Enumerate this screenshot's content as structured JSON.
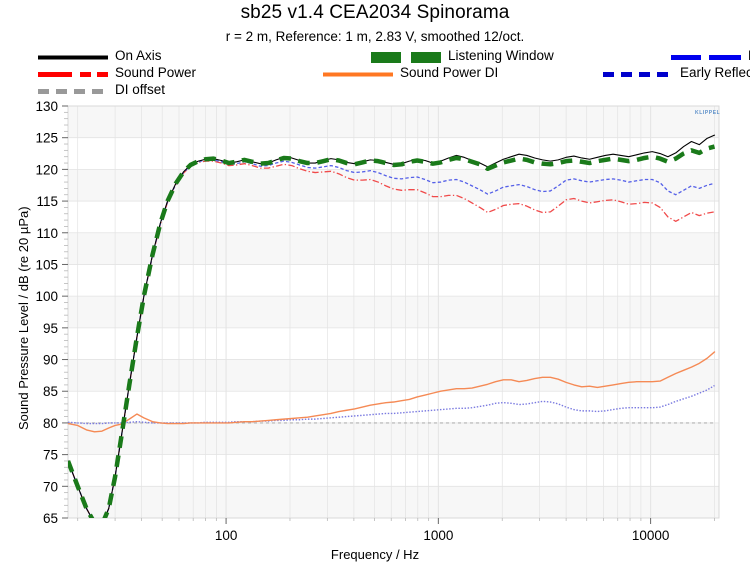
{
  "chart_data": {
    "type": "line",
    "title": "sb25 v1.4 CEA2034 Spinorama",
    "subtitle": "r = 2 m,  Reference: 1 m, 2.83 V, smoothed 12/oct.",
    "xlabel": "Frequency / Hz",
    "ylabel": "Sound Pressure Level / dB (re 20 µPa)",
    "xscale": "log",
    "xlim": [
      18,
      21000
    ],
    "ylim": [
      65,
      130
    ],
    "yticks": [
      65,
      70,
      75,
      80,
      85,
      90,
      95,
      100,
      105,
      110,
      115,
      120,
      125,
      130
    ],
    "xticks": [
      100,
      1000,
      10000
    ],
    "xtick_labels": [
      "100",
      "1000",
      "10000"
    ],
    "grid": true,
    "legend_position": "above-plot",
    "watermark": "KLIPPEL",
    "band_color": "#f7f7f7",
    "grid_color": "#e3e3e3",
    "series": [
      {
        "name": "On Axis",
        "color": "#000000",
        "style": "solid",
        "width": 1.1,
        "x": [
          18,
          20,
          22,
          24,
          26,
          28,
          30,
          32,
          35,
          38,
          41,
          45,
          49,
          53,
          58,
          63,
          68,
          74,
          80,
          87,
          95,
          103,
          112,
          122,
          133,
          145,
          158,
          172,
          187,
          204,
          222,
          242,
          263,
          287,
          312,
          340,
          370,
          403,
          439,
          478,
          520,
          566,
          616,
          671,
          730,
          795,
          866,
          942,
          1026,
          1117,
          1216,
          1324,
          1441,
          1569,
          1708,
          1860,
          2025,
          2204,
          2400,
          2613,
          2845,
          3097,
          3372,
          3671,
          3997,
          4351,
          4737,
          5158,
          5615,
          6113,
          6656,
          7246,
          7889,
          8589,
          9351,
          10180,
          11084,
          12067,
          13138,
          14304,
          15574,
          16956,
          18462,
          20000
        ],
        "y": [
          74.0,
          70.0,
          66.5,
          64.2,
          63.9,
          66.5,
          71.5,
          77.5,
          86.0,
          93.5,
          100.0,
          106.5,
          111.5,
          115.0,
          117.8,
          119.6,
          120.7,
          121.3,
          121.6,
          121.7,
          121.4,
          121.0,
          121.2,
          121.5,
          121.2,
          120.9,
          121.0,
          121.5,
          121.9,
          121.8,
          121.4,
          121.0,
          121.0,
          121.4,
          121.7,
          121.5,
          121.1,
          120.9,
          121.2,
          121.5,
          121.4,
          121.1,
          120.8,
          120.9,
          121.3,
          121.6,
          121.4,
          121.0,
          121.3,
          121.8,
          122.2,
          121.9,
          121.4,
          121.0,
          120.4,
          121.0,
          121.6,
          122.0,
          122.4,
          122.2,
          121.8,
          121.5,
          121.3,
          121.5,
          121.9,
          122.1,
          121.8,
          121.6,
          121.9,
          122.2,
          122.4,
          122.2,
          122.0,
          122.3,
          122.6,
          122.8,
          122.5,
          122.0,
          122.6,
          123.6,
          124.4,
          123.9,
          124.9,
          125.4,
          123.2
        ]
      },
      {
        "name": "Listening Window",
        "color": "#1a7a1a",
        "style": "dashed",
        "width": 4.5,
        "x": [
          18,
          20,
          22,
          24,
          26,
          28,
          30,
          32,
          35,
          38,
          41,
          45,
          49,
          53,
          58,
          63,
          68,
          74,
          80,
          87,
          95,
          103,
          112,
          122,
          133,
          145,
          158,
          172,
          187,
          204,
          222,
          242,
          263,
          287,
          312,
          340,
          370,
          403,
          439,
          478,
          520,
          566,
          616,
          671,
          730,
          795,
          866,
          942,
          1026,
          1117,
          1216,
          1324,
          1441,
          1569,
          1708,
          1860,
          2025,
          2204,
          2400,
          2613,
          2845,
          3097,
          3372,
          3671,
          3997,
          4351,
          4737,
          5158,
          5615,
          6113,
          6656,
          7246,
          7889,
          8589,
          9351,
          10180,
          11084,
          12067,
          13138,
          14304,
          15574,
          16956,
          18462,
          20000
        ],
        "y": [
          74.0,
          70.0,
          66.5,
          64.2,
          63.9,
          66.5,
          71.5,
          77.5,
          86.0,
          93.5,
          100.0,
          106.5,
          111.5,
          115.0,
          117.8,
          119.6,
          120.7,
          121.3,
          121.6,
          121.7,
          121.4,
          121.0,
          121.2,
          121.5,
          121.2,
          120.9,
          121.0,
          121.4,
          121.8,
          121.7,
          121.3,
          121.0,
          121.0,
          121.3,
          121.6,
          121.4,
          121.0,
          120.8,
          121.1,
          121.4,
          121.3,
          121.0,
          120.7,
          120.8,
          121.2,
          121.4,
          121.2,
          120.9,
          121.1,
          121.5,
          121.8,
          121.6,
          121.2,
          120.8,
          120.1,
          120.6,
          121.1,
          121.4,
          121.7,
          121.5,
          121.1,
          120.9,
          120.8,
          121.0,
          121.3,
          121.4,
          121.2,
          121.0,
          121.3,
          121.5,
          121.7,
          121.5,
          121.3,
          121.5,
          121.8,
          122.0,
          121.7,
          121.2,
          121.7,
          122.5,
          123.0,
          122.6,
          123.3,
          123.6,
          122.0
        ]
      },
      {
        "name": "Early Reflections",
        "color": "#5560e8",
        "style": "dashed",
        "width": 1.3,
        "x": [
          18,
          20,
          22,
          24,
          26,
          28,
          30,
          32,
          35,
          38,
          41,
          45,
          49,
          53,
          58,
          63,
          68,
          74,
          80,
          87,
          95,
          103,
          112,
          122,
          133,
          145,
          158,
          172,
          187,
          204,
          222,
          242,
          263,
          287,
          312,
          340,
          370,
          403,
          439,
          478,
          520,
          566,
          616,
          671,
          730,
          795,
          866,
          942,
          1026,
          1117,
          1216,
          1324,
          1441,
          1569,
          1708,
          1860,
          2025,
          2204,
          2400,
          2613,
          2845,
          3097,
          3372,
          3671,
          3997,
          4351,
          4737,
          5158,
          5615,
          6113,
          6656,
          7246,
          7889,
          8589,
          9351,
          10180,
          11084,
          12067,
          13138,
          14304,
          15574,
          16956,
          18462,
          20000
        ],
        "y": [
          74.0,
          70.0,
          66.5,
          64.2,
          63.9,
          66.5,
          71.5,
          77.5,
          86.0,
          93.5,
          100.0,
          106.4,
          111.4,
          114.9,
          117.7,
          119.5,
          120.6,
          121.2,
          121.5,
          121.5,
          121.2,
          120.8,
          120.9,
          121.2,
          120.9,
          120.5,
          120.6,
          121.0,
          121.3,
          121.1,
          120.7,
          120.3,
          120.2,
          120.4,
          120.6,
          120.3,
          119.8,
          119.5,
          119.6,
          119.8,
          119.5,
          119.0,
          118.6,
          118.5,
          118.7,
          118.8,
          118.4,
          117.9,
          118.0,
          118.3,
          118.4,
          118.0,
          117.4,
          116.8,
          116.1,
          116.6,
          117.2,
          117.4,
          117.6,
          117.3,
          116.8,
          116.5,
          116.6,
          117.4,
          118.3,
          118.5,
          118.2,
          118.0,
          118.2,
          118.4,
          118.5,
          118.3,
          118.0,
          118.2,
          118.4,
          118.4,
          117.9,
          116.6,
          116.0,
          116.7,
          117.4,
          117.0,
          117.5,
          117.8,
          115.5
        ]
      },
      {
        "name": "Sound Power",
        "color": "#f04a4a",
        "style": "dashdot",
        "width": 1.3,
        "x": [
          18,
          20,
          22,
          24,
          26,
          28,
          30,
          32,
          35,
          38,
          41,
          45,
          49,
          53,
          58,
          63,
          68,
          74,
          80,
          87,
          95,
          103,
          112,
          122,
          133,
          145,
          158,
          172,
          187,
          204,
          222,
          242,
          263,
          287,
          312,
          340,
          370,
          403,
          439,
          478,
          520,
          566,
          616,
          671,
          730,
          795,
          866,
          942,
          1026,
          1117,
          1216,
          1324,
          1441,
          1569,
          1708,
          1860,
          2025,
          2204,
          2400,
          2613,
          2845,
          3097,
          3372,
          3671,
          3997,
          4351,
          4737,
          5158,
          5615,
          6113,
          6656,
          7246,
          7889,
          8589,
          9351,
          10180,
          11084,
          12067,
          13138,
          14304,
          15574,
          16956,
          18462,
          20000
        ],
        "y": [
          74.0,
          70.0,
          66.5,
          64.2,
          63.9,
          66.5,
          71.5,
          77.5,
          86.0,
          93.5,
          100.0,
          106.3,
          111.3,
          114.8,
          117.6,
          119.4,
          120.5,
          121.1,
          121.3,
          121.3,
          121.0,
          120.6,
          120.7,
          120.9,
          120.6,
          120.2,
          120.2,
          120.5,
          120.8,
          120.6,
          120.1,
          119.7,
          119.5,
          119.6,
          119.7,
          119.3,
          118.7,
          118.3,
          118.3,
          118.4,
          118.0,
          117.4,
          116.9,
          116.7,
          116.8,
          116.8,
          116.3,
          115.7,
          115.7,
          115.9,
          115.9,
          115.4,
          114.7,
          114.0,
          113.2,
          113.7,
          114.3,
          114.5,
          114.6,
          114.2,
          113.6,
          113.2,
          113.3,
          114.2,
          115.2,
          115.4,
          115.0,
          114.7,
          114.9,
          115.1,
          115.2,
          114.9,
          114.5,
          114.6,
          114.8,
          114.7,
          114.0,
          112.5,
          111.8,
          112.5,
          113.2,
          112.7,
          113.1,
          113.3,
          110.7
        ]
      },
      {
        "name": "Sound Power DI",
        "color": "#f58a55",
        "style": "solid",
        "width": 1.4,
        "x": [
          18,
          20,
          22,
          24,
          26,
          28,
          30,
          32,
          35,
          38,
          41,
          45,
          49,
          53,
          58,
          63,
          68,
          74,
          80,
          87,
          95,
          103,
          112,
          122,
          133,
          145,
          158,
          172,
          187,
          204,
          222,
          242,
          263,
          287,
          312,
          340,
          370,
          403,
          439,
          478,
          520,
          566,
          616,
          671,
          730,
          795,
          866,
          942,
          1026,
          1117,
          1216,
          1324,
          1441,
          1569,
          1708,
          1860,
          2025,
          2204,
          2400,
          2613,
          2845,
          3097,
          3372,
          3671,
          3997,
          4351,
          4737,
          5158,
          5615,
          6113,
          6656,
          7246,
          7889,
          8589,
          9351,
          10180,
          11084,
          12067,
          13138,
          14304,
          15574,
          16956,
          18462,
          20000
        ],
        "y": [
          79.9,
          79.6,
          78.9,
          78.6,
          78.7,
          79.2,
          79.6,
          79.8,
          80.6,
          81.4,
          80.8,
          80.2,
          80.0,
          79.9,
          79.9,
          79.9,
          80.0,
          80.0,
          80.0,
          80.0,
          80.0,
          80.0,
          80.1,
          80.2,
          80.2,
          80.3,
          80.4,
          80.5,
          80.6,
          80.7,
          80.8,
          80.9,
          81.1,
          81.3,
          81.5,
          81.8,
          82.0,
          82.2,
          82.5,
          82.8,
          83.0,
          83.2,
          83.3,
          83.5,
          83.7,
          84.1,
          84.4,
          84.7,
          85.0,
          85.2,
          85.4,
          85.4,
          85.5,
          85.8,
          86.1,
          86.5,
          86.8,
          86.8,
          86.5,
          86.7,
          87.0,
          87.2,
          87.2,
          86.9,
          86.4,
          86.0,
          85.7,
          85.8,
          85.6,
          85.8,
          86.0,
          86.2,
          86.4,
          86.5,
          86.5,
          86.5,
          86.6,
          87.2,
          87.8,
          88.3,
          88.8,
          89.4,
          90.2,
          91.2,
          90.8
        ]
      },
      {
        "name": "Early Reflections DI",
        "color": "#7a7ae0",
        "style": "dotted",
        "width": 1.4,
        "x": [
          18,
          20,
          22,
          24,
          26,
          28,
          30,
          32,
          35,
          38,
          41,
          45,
          49,
          53,
          58,
          63,
          68,
          74,
          80,
          87,
          95,
          103,
          112,
          122,
          133,
          145,
          158,
          172,
          187,
          204,
          222,
          242,
          263,
          287,
          312,
          340,
          370,
          403,
          439,
          478,
          520,
          566,
          616,
          671,
          730,
          795,
          866,
          942,
          1026,
          1117,
          1216,
          1324,
          1441,
          1569,
          1708,
          1860,
          2025,
          2204,
          2400,
          2613,
          2845,
          3097,
          3372,
          3671,
          3997,
          4351,
          4737,
          5158,
          5615,
          6113,
          6656,
          7246,
          7889,
          8589,
          9351,
          10180,
          11084,
          12067,
          13138,
          14304,
          15574,
          16956,
          18462,
          20000
        ],
        "y": [
          80.1,
          80.0,
          79.9,
          79.9,
          79.9,
          80.0,
          80.0,
          80.0,
          80.1,
          80.2,
          80.1,
          80.0,
          80.0,
          80.0,
          80.0,
          80.0,
          80.0,
          80.0,
          80.1,
          80.1,
          80.1,
          80.1,
          80.2,
          80.2,
          80.2,
          80.3,
          80.3,
          80.4,
          80.4,
          80.5,
          80.5,
          80.6,
          80.6,
          80.7,
          80.8,
          80.9,
          81.0,
          81.1,
          81.2,
          81.3,
          81.4,
          81.5,
          81.5,
          81.6,
          81.7,
          81.8,
          81.9,
          82.0,
          82.1,
          82.2,
          82.3,
          82.3,
          82.4,
          82.6,
          82.8,
          83.1,
          83.2,
          83.1,
          82.9,
          83.0,
          83.2,
          83.4,
          83.3,
          83.0,
          82.5,
          82.1,
          81.9,
          81.9,
          81.8,
          81.9,
          82.1,
          82.3,
          82.4,
          82.4,
          82.4,
          82.4,
          82.5,
          82.9,
          83.4,
          83.8,
          84.2,
          84.7,
          85.2,
          85.9,
          85.5
        ]
      },
      {
        "name": "DI offset",
        "color": "#b0b0b0",
        "style": "dashed-thick-dotted",
        "width": 1.2,
        "x": [
          18,
          20000
        ],
        "y": [
          80.0,
          80.0
        ]
      }
    ]
  },
  "legend": {
    "rows": [
      [
        {
          "label": "On Axis",
          "swatch": "solid",
          "color": "#000000"
        },
        {
          "label": "Listening Window",
          "swatch": "dashed-thick",
          "color": "#1a7a1a"
        },
        {
          "label": "Early Reflections",
          "swatch": "dashed-medium",
          "color": "#0000ee"
        }
      ],
      [
        {
          "label": "Sound Power",
          "swatch": "dashdot",
          "color": "#ff0000"
        },
        {
          "label": "Sound Power DI",
          "swatch": "solid",
          "color": "#ff7722"
        },
        {
          "label": "Early Reflections DI",
          "swatch": "dashed-short",
          "color": "#0000cc"
        }
      ],
      [
        {
          "label": "DI offset",
          "swatch": "dashed-short",
          "color": "#999999"
        }
      ]
    ]
  },
  "watermark": {
    "text": "KLIPPEL"
  }
}
